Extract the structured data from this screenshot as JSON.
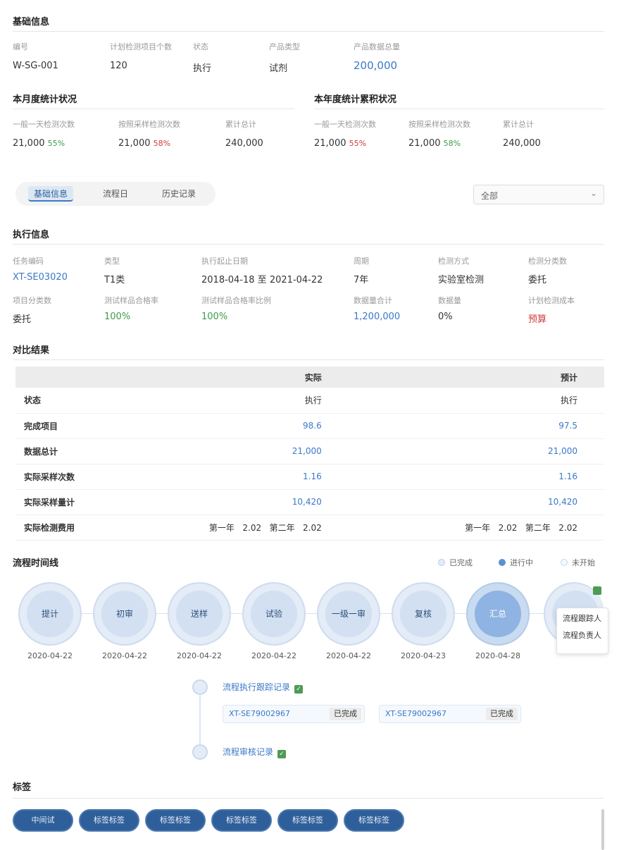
{
  "basic": {
    "title": "基础信息",
    "fields": [
      {
        "label": "编号",
        "value": "W-SG-001"
      },
      {
        "label": "计划检测项目个数",
        "value": "120"
      },
      {
        "label": "状态",
        "value": "执行"
      },
      {
        "label": "产品类型",
        "value": "试剂"
      },
      {
        "label": "产品数据总量",
        "value": "200,000"
      }
    ]
  },
  "stat_left": {
    "title": "本月度统计状况",
    "fields": [
      {
        "label": "一般一天检测次数",
        "value": "21,000",
        "delta": "55%"
      },
      {
        "label": "按照采样检测次数",
        "value": "21,000",
        "delta": "58%"
      },
      {
        "label": "累计总计",
        "value": "240,000"
      }
    ]
  },
  "stat_right": {
    "title": "本年度统计累积状况",
    "fields": [
      {
        "label": "一般一天检测次数",
        "value": "21,000",
        "delta": "55%"
      },
      {
        "label": "按照采样检测次数",
        "value": "21,000",
        "delta": "58%"
      },
      {
        "label": "累计总计",
        "value": "240,000"
      }
    ]
  },
  "tabs": [
    "基础信息",
    "流程日",
    "历史记录"
  ],
  "select": {
    "value": "全部"
  },
  "detail": {
    "title": "执行信息",
    "row1": [
      {
        "label": "任务编码",
        "value": "XT-SE03020"
      },
      {
        "label": "类型",
        "value": "T1类"
      },
      {
        "label": "执行起止日期",
        "value": "2018-04-18 至 2021-04-22"
      },
      {
        "label": "周期",
        "value": "7年"
      },
      {
        "label": "检测方式",
        "value": "实验室检测"
      },
      {
        "label": "检测分类数",
        "value": "委托"
      }
    ],
    "row2": [
      {
        "label": "项目分类数",
        "value": "委托"
      },
      {
        "label": "测试样品合格率",
        "value": "100%"
      },
      {
        "label": "测试样品合格率比例",
        "value": "100%"
      },
      {
        "label": "数据量合计",
        "value": "1,200,000"
      },
      {
        "label": "数据量",
        "value": "0%"
      },
      {
        "label": "计划检测成本",
        "value": "预算"
      }
    ]
  },
  "compare": {
    "title": "对比结果",
    "headers": [
      "",
      "实际",
      "预计"
    ],
    "rows": [
      {
        "name": "状态",
        "a": "执行",
        "b": "执行",
        "link": false
      },
      {
        "name": "完成项目",
        "a": "98.6",
        "b": "97.5",
        "link": true
      },
      {
        "name": "数据总计",
        "a": "21,000",
        "b": "21,000",
        "link": true
      },
      {
        "name": "实际采样次数",
        "a": "1.16",
        "b": "1.16",
        "link": true
      },
      {
        "name": "实际采样量计",
        "a": "10,420",
        "b": "10,420",
        "link": true
      },
      {
        "name": "实际检测费用",
        "a": [
          "第一年",
          "2.02",
          "第二年",
          "2.02"
        ],
        "b": [
          "第一年",
          "2.02",
          "第二年",
          "2.02"
        ],
        "link": false
      }
    ]
  },
  "flow": {
    "title": "流程时间线",
    "legend": [
      "已完成",
      "进行中",
      "未开始"
    ],
    "nodes": [
      {
        "label": "提计",
        "date": "2020-04-22"
      },
      {
        "label": "初审",
        "date": "2020-04-22"
      },
      {
        "label": "送样",
        "date": "2020-04-22"
      },
      {
        "label": "试验",
        "date": "2020-04-22"
      },
      {
        "label": "一级一审",
        "date": "2020-04-22"
      },
      {
        "label": "复核",
        "date": "2020-04-23"
      },
      {
        "label": "汇总",
        "date": "2020-04-28"
      },
      {
        "label": "",
        "date": ""
      }
    ],
    "tooltip": [
      "流程跟踪人",
      "流程负责人"
    ],
    "sub_items": [
      {
        "title": "流程执行跟踪记录",
        "chips": [
          {
            "a": "XT-SE79002967",
            "b": "已完成"
          },
          {
            "a": "XT-SE79002967",
            "b": "已完成"
          }
        ]
      },
      {
        "title": "流程审核记录"
      }
    ]
  },
  "tags": {
    "title": "标签",
    "items": [
      "中间试",
      "标签标签",
      "标签标签",
      "标签标签",
      "标签标签",
      "标签标签"
    ]
  }
}
